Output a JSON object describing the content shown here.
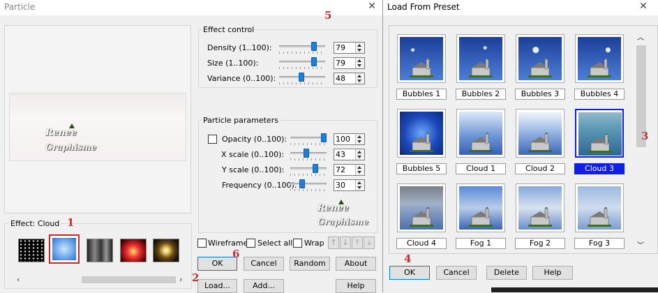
{
  "particle_dialog": {
    "title": "Particle",
    "effect_label": "Effect: Cloud",
    "watermark_line1": "Renee",
    "watermark_line2": "Graphisme",
    "effect_control": {
      "label": "Effect control",
      "rows": [
        {
          "label": "Density (1..100):",
          "value": "79",
          "level": 79
        },
        {
          "label": "Size (1..100):",
          "value": "79",
          "level": 79
        },
        {
          "label": "Variance (0..100):",
          "value": "48",
          "level": 48
        }
      ]
    },
    "particle_parameters": {
      "label": "Particle parameters",
      "rows": [
        {
          "label": "Opacity (0..100):",
          "value": "100",
          "level": 100
        },
        {
          "label": "X scale (0..100):",
          "value": "43",
          "level": 43
        },
        {
          "label": "Y scale (0..100):",
          "value": "72",
          "level": 72
        },
        {
          "label": "Frequency (0..100):",
          "value": "30",
          "level": 30
        }
      ]
    },
    "checkboxes": {
      "wireframe": "Wireframe",
      "select_all": "Select all",
      "wrap": "Wrap"
    },
    "buttons": {
      "ok": "OK",
      "cancel": "Cancel",
      "random": "Random",
      "about": "About",
      "load": "Load...",
      "add": "Add...",
      "help": "Help"
    },
    "step_markers": {
      "m1": "1",
      "m2": "2",
      "m5": "5",
      "m6": "6"
    }
  },
  "preset_dialog": {
    "title": "Load From Preset",
    "presets": [
      "Bubbles 1",
      "Bubbles 2",
      "Bubbles 3",
      "Bubbles 4",
      "Bubbles 5",
      "Cloud 1",
      "Cloud 2",
      "Cloud 3",
      "Cloud 4",
      "Fog 1",
      "Fog 2",
      "Fog 3"
    ],
    "selected": "Cloud 3",
    "buttons": {
      "ok": "OK",
      "cancel": "Cancel",
      "delete": "Delete",
      "help": "Help"
    },
    "step_markers": {
      "m3": "3",
      "m4": "4"
    }
  },
  "colors": {
    "selection": "#0f1fe8",
    "slider_thumb": "#1e7fd8",
    "marker_red": "#b33333",
    "focus_red": "#c62828"
  }
}
